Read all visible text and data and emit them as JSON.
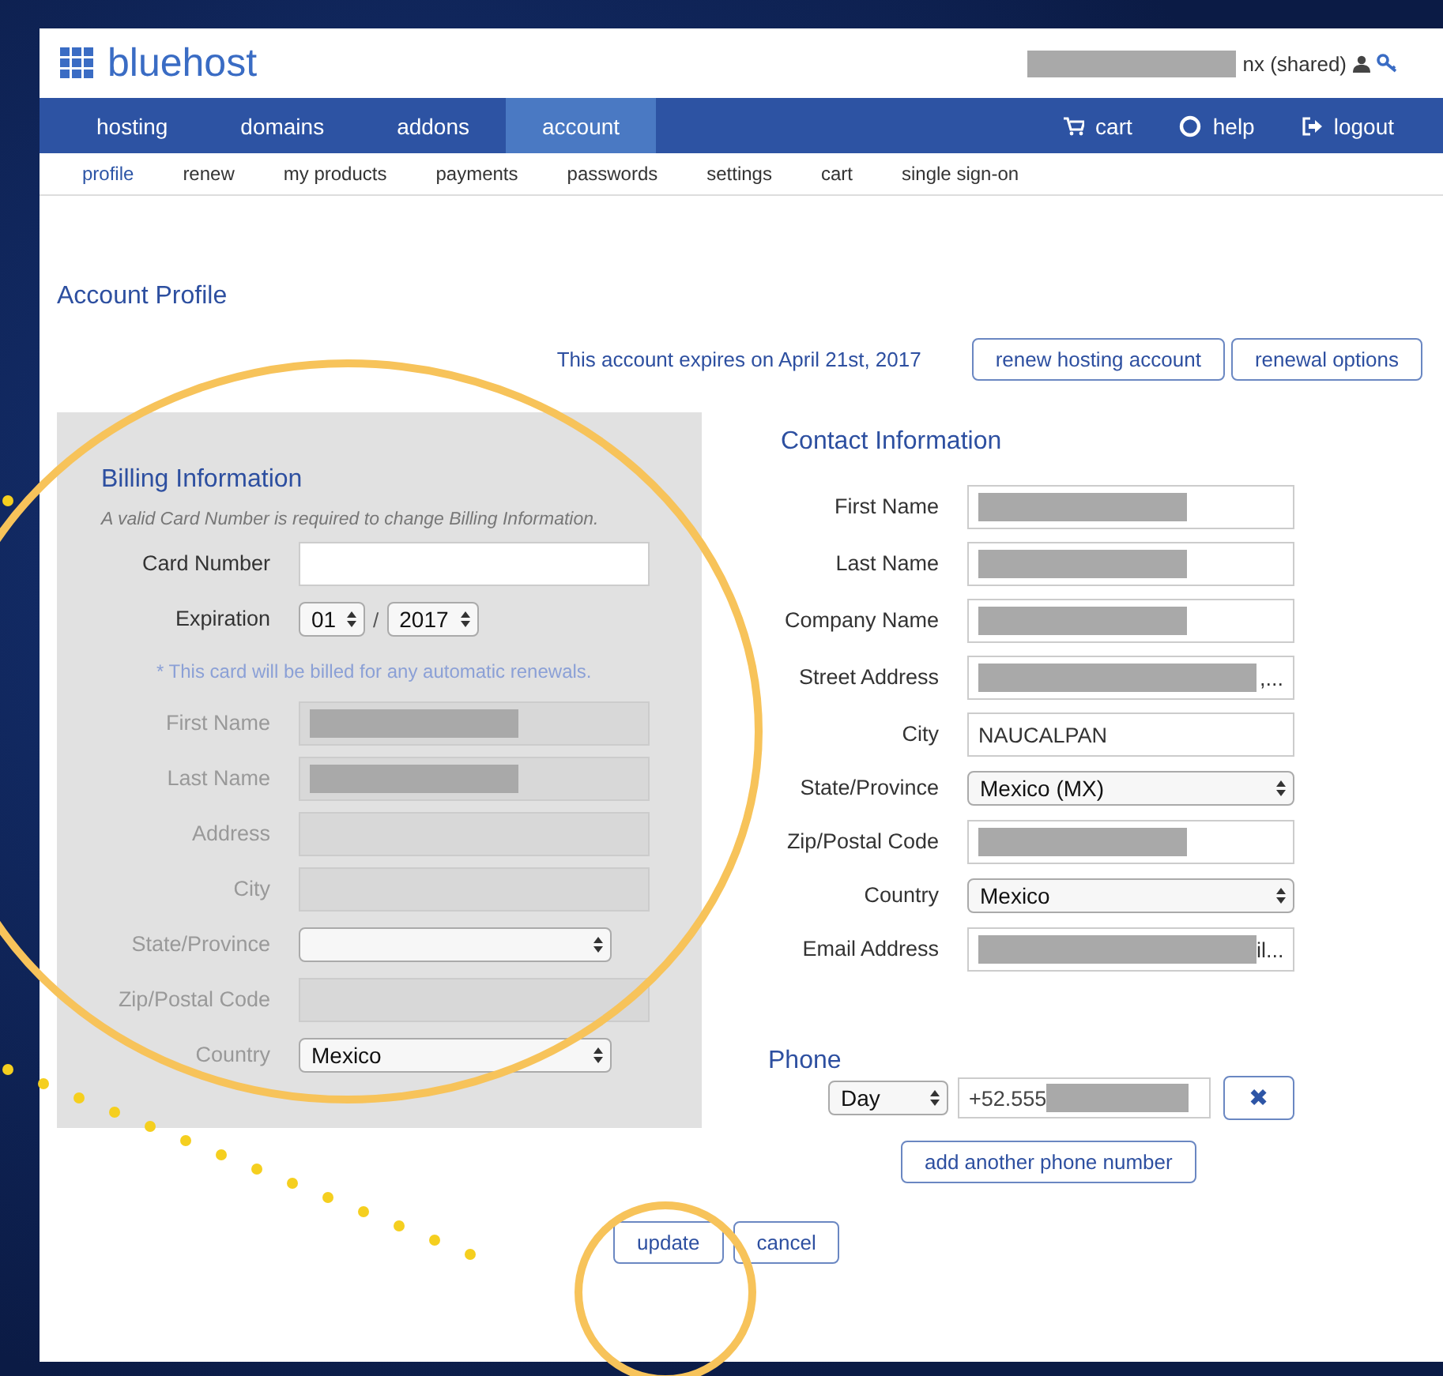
{
  "header": {
    "logo": "bluehost",
    "account_label": "nx (shared)"
  },
  "nav": [
    {
      "label": "hosting",
      "selected": false
    },
    {
      "label": "domains",
      "selected": false
    },
    {
      "label": "addons",
      "selected": false
    },
    {
      "label": "account",
      "selected": true
    }
  ],
  "nav_right": [
    {
      "label": "cart",
      "kind": "cart"
    },
    {
      "label": "help",
      "kind": "help"
    },
    {
      "label": "logout",
      "kind": "logout"
    }
  ],
  "subnav": [
    {
      "label": "profile",
      "selected": true
    },
    {
      "label": "renew",
      "selected": false
    },
    {
      "label": "my products",
      "selected": false
    },
    {
      "label": "payments",
      "selected": false
    },
    {
      "label": "passwords",
      "selected": false
    },
    {
      "label": "settings",
      "selected": false
    },
    {
      "label": "cart",
      "selected": false
    },
    {
      "label": "single sign-on",
      "selected": false
    }
  ],
  "page_title": "Account Profile",
  "expiry": {
    "text": "This account expires on April 21st, 2017",
    "buttons": [
      "renew hosting account",
      "renewal options"
    ]
  },
  "billing": {
    "title": "Billing Information",
    "notice": "A valid Card Number is required to change Billing Information.",
    "rows": [
      {
        "kind": "text",
        "label": "Card Number",
        "disabled": false,
        "redacted": false
      },
      {
        "kind": "expiration",
        "label": "Expiration",
        "month": "01",
        "separator": "/",
        "year": "2017"
      },
      {
        "kind": "note",
        "text": "* This card will be billed for any automatic renewals."
      },
      {
        "kind": "text",
        "label": "First Name",
        "disabled": true,
        "redacted": true
      },
      {
        "kind": "text",
        "label": "Last Name",
        "disabled": true,
        "redacted": true
      },
      {
        "kind": "text",
        "label": "Address",
        "disabled": true,
        "redacted": false
      },
      {
        "kind": "text",
        "label": "City",
        "disabled": true,
        "redacted": false
      },
      {
        "kind": "select",
        "label": "State/Province",
        "disabled": true
      },
      {
        "kind": "text",
        "label": "Zip/Postal Code",
        "disabled": true,
        "redacted": false
      },
      {
        "kind": "select",
        "label": "Country",
        "value": "Mexico",
        "disabled": true
      }
    ]
  },
  "contact": {
    "title": "Contact Information",
    "rows": [
      {
        "kind": "text",
        "label": "First Name",
        "redacted": true
      },
      {
        "kind": "text",
        "label": "Last Name",
        "redacted": true
      },
      {
        "kind": "text",
        "label": "Company Name",
        "redacted": true
      },
      {
        "kind": "text",
        "label": "Street Address",
        "redacted": true,
        "value": ",..."
      },
      {
        "kind": "text",
        "label": "City",
        "redacted": false,
        "value": "NAUCALPAN"
      },
      {
        "kind": "select",
        "label": "State/Province",
        "value": "Mexico (MX)"
      },
      {
        "kind": "text",
        "label": "Zip/Postal Code",
        "redacted": true
      },
      {
        "kind": "select",
        "label": "Country",
        "value": "Mexico"
      },
      {
        "kind": "text",
        "label": "Email Address",
        "redacted": true,
        "value": "il..."
      }
    ]
  },
  "phone": {
    "title": "Phone",
    "type": "Day",
    "number": "+52.555",
    "redacted": true,
    "remove_button": "✖",
    "add_button": "add another phone number"
  },
  "actions": [
    "update",
    "cancel"
  ]
}
